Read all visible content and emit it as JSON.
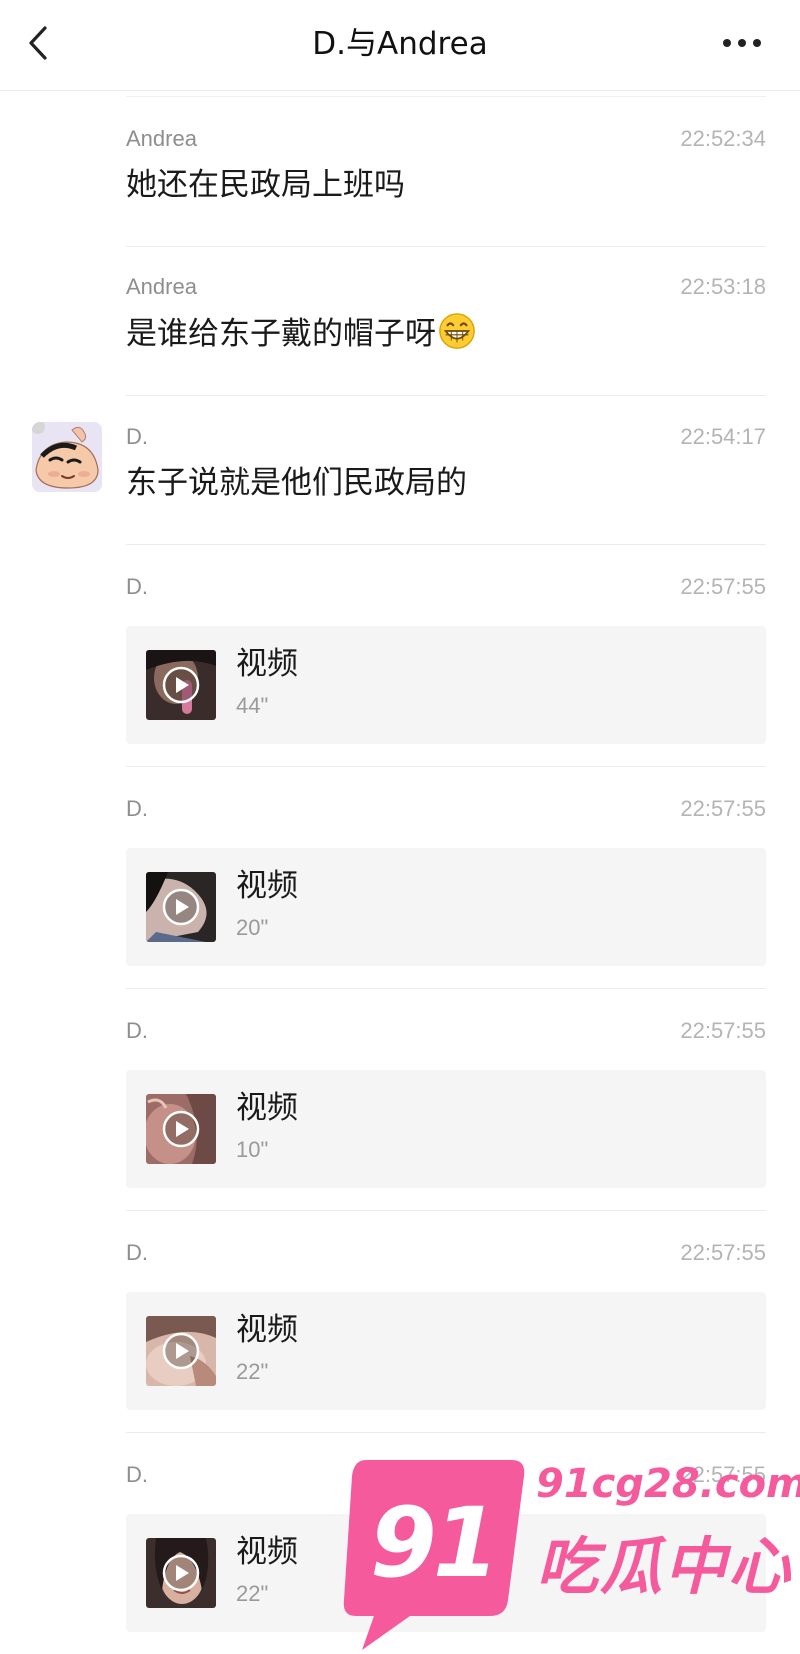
{
  "header": {
    "title": "D.与Andrea",
    "back_icon": "chevron-left-icon",
    "more_icon": "more-horizontal-icon"
  },
  "messages": [
    {
      "sender": "Andrea",
      "time": "22:52:34",
      "type": "text",
      "text": "她还在民政局上班吗"
    },
    {
      "sender": "Andrea",
      "time": "22:53:18",
      "type": "text",
      "text": "是谁给东子戴的帽子呀",
      "emoji": "grinning-face-emoji"
    },
    {
      "sender": "D.",
      "time": "22:54:17",
      "type": "text",
      "text": "东子说就是他们民政局的",
      "avatar": "cartoon-avatar"
    },
    {
      "sender": "D.",
      "time": "22:57:55",
      "type": "video",
      "label": "视频",
      "duration": "44\""
    },
    {
      "sender": "D.",
      "time": "22:57:55",
      "type": "video",
      "label": "视频",
      "duration": "20\""
    },
    {
      "sender": "D.",
      "time": "22:57:55",
      "type": "video",
      "label": "视频",
      "duration": "10\""
    },
    {
      "sender": "D.",
      "time": "22:57:55",
      "type": "video",
      "label": "视频",
      "duration": "22\""
    },
    {
      "sender": "D.",
      "time": "22:57:55",
      "type": "video",
      "label": "视频",
      "duration": "22\""
    }
  ],
  "watermark": {
    "number": "91",
    "domain": "91cg28.com",
    "name": "吃瓜中心"
  },
  "colors": {
    "accent": "#f55a9c",
    "card_bg": "#f5f5f5",
    "time": "#b4b4b4"
  }
}
